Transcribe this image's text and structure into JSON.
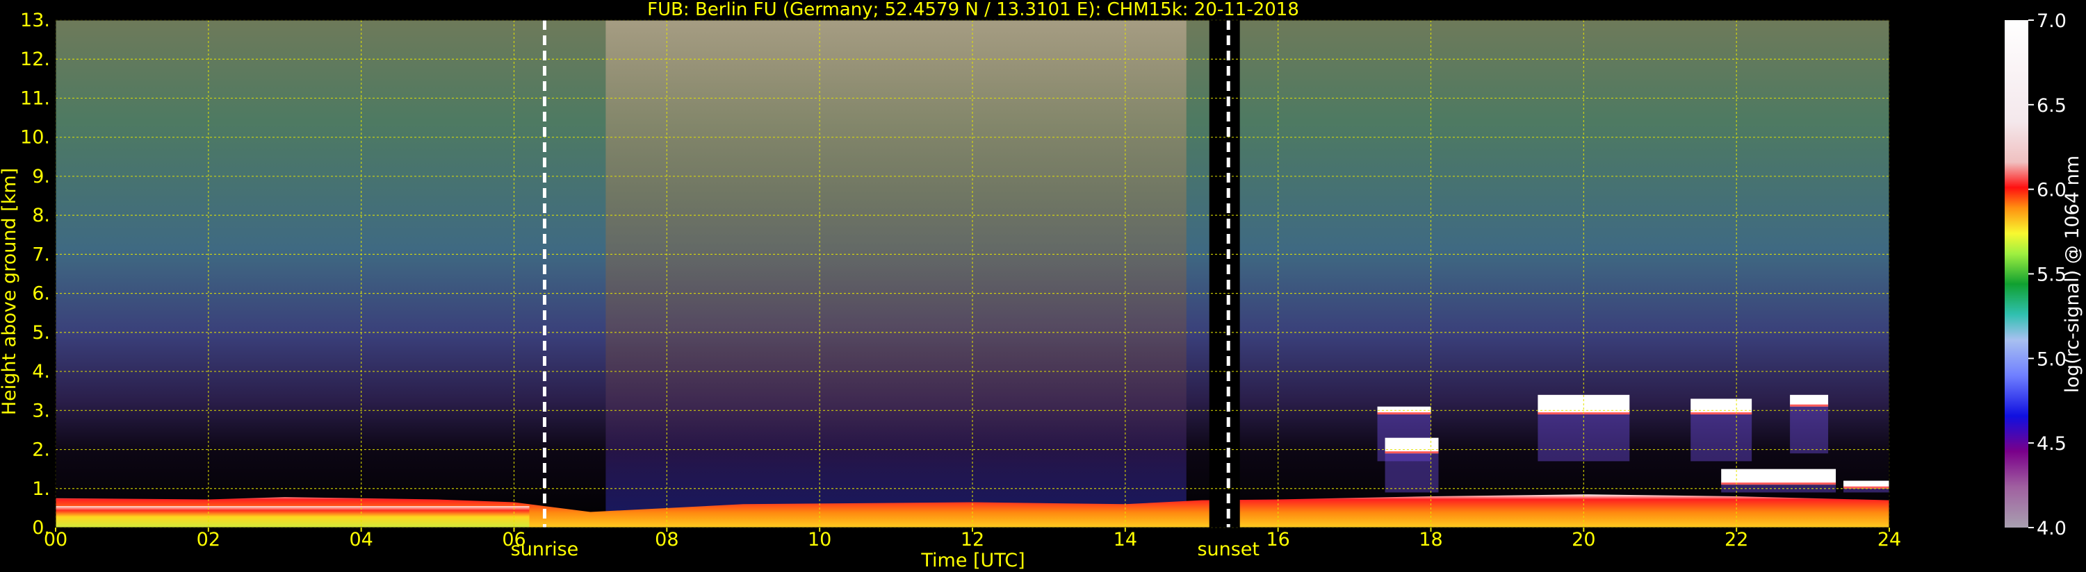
{
  "chart_data": {
    "type": "heatmap",
    "title": "FUB: Berlin FU (Germany; 52.4579 N / 13.3101 E):    CHM15k: 20-11-2018",
    "xlabel": "Time [UTC]",
    "ylabel": "Height above ground [km]",
    "xlim": [
      0,
      24
    ],
    "ylim": [
      0,
      13
    ],
    "x_ticks": [
      "00",
      "02",
      "04",
      "06",
      "08",
      "10",
      "12",
      "14",
      "16",
      "18",
      "20",
      "22",
      "24"
    ],
    "y_ticks": [
      "0.",
      "1.",
      "2.",
      "3.",
      "4.",
      "5.",
      "6.",
      "7.",
      "8.",
      "9.",
      "10.",
      "11.",
      "12.",
      "13."
    ],
    "grid": true,
    "colorbar": {
      "label": "log(rc-signal) @ 1064 nm",
      "range": [
        4.0,
        7.0
      ],
      "ticks": [
        "4.0",
        "4.5",
        "5.0",
        "5.5",
        "6.0",
        "6.5",
        "7.0"
      ]
    },
    "annotations": [
      {
        "text": "sunrise",
        "time": 6.4
      },
      {
        "text": "sunset",
        "time": 15.35
      }
    ],
    "data_gaps": [
      [
        15.1,
        15.5
      ]
    ],
    "boundary_layer_top_km": [
      [
        0,
        0.75
      ],
      [
        2,
        0.72
      ],
      [
        3,
        0.78
      ],
      [
        5,
        0.72
      ],
      [
        6,
        0.65
      ],
      [
        7,
        0.4
      ],
      [
        9,
        0.6
      ],
      [
        12,
        0.65
      ],
      [
        14,
        0.6
      ],
      [
        15,
        0.7
      ],
      [
        16,
        0.72
      ],
      [
        18,
        0.8
      ],
      [
        20,
        0.85
      ],
      [
        22,
        0.8
      ],
      [
        24,
        0.7
      ]
    ],
    "cloud_layers": [
      {
        "start": 17.3,
        "end": 18.0,
        "base_km": 2.9,
        "top_km": 3.1
      },
      {
        "start": 17.4,
        "end": 18.1,
        "base_km": 1.9,
        "top_km": 2.3
      },
      {
        "start": 19.4,
        "end": 20.6,
        "base_km": 2.9,
        "top_km": 3.4
      },
      {
        "start": 21.4,
        "end": 22.2,
        "base_km": 2.9,
        "top_km": 3.3
      },
      {
        "start": 22.7,
        "end": 23.2,
        "base_km": 3.1,
        "top_km": 3.4
      },
      {
        "start": 21.8,
        "end": 23.3,
        "base_km": 1.1,
        "top_km": 1.5
      },
      {
        "start": 23.4,
        "end": 24.0,
        "base_km": 1.0,
        "top_km": 1.2
      }
    ]
  }
}
